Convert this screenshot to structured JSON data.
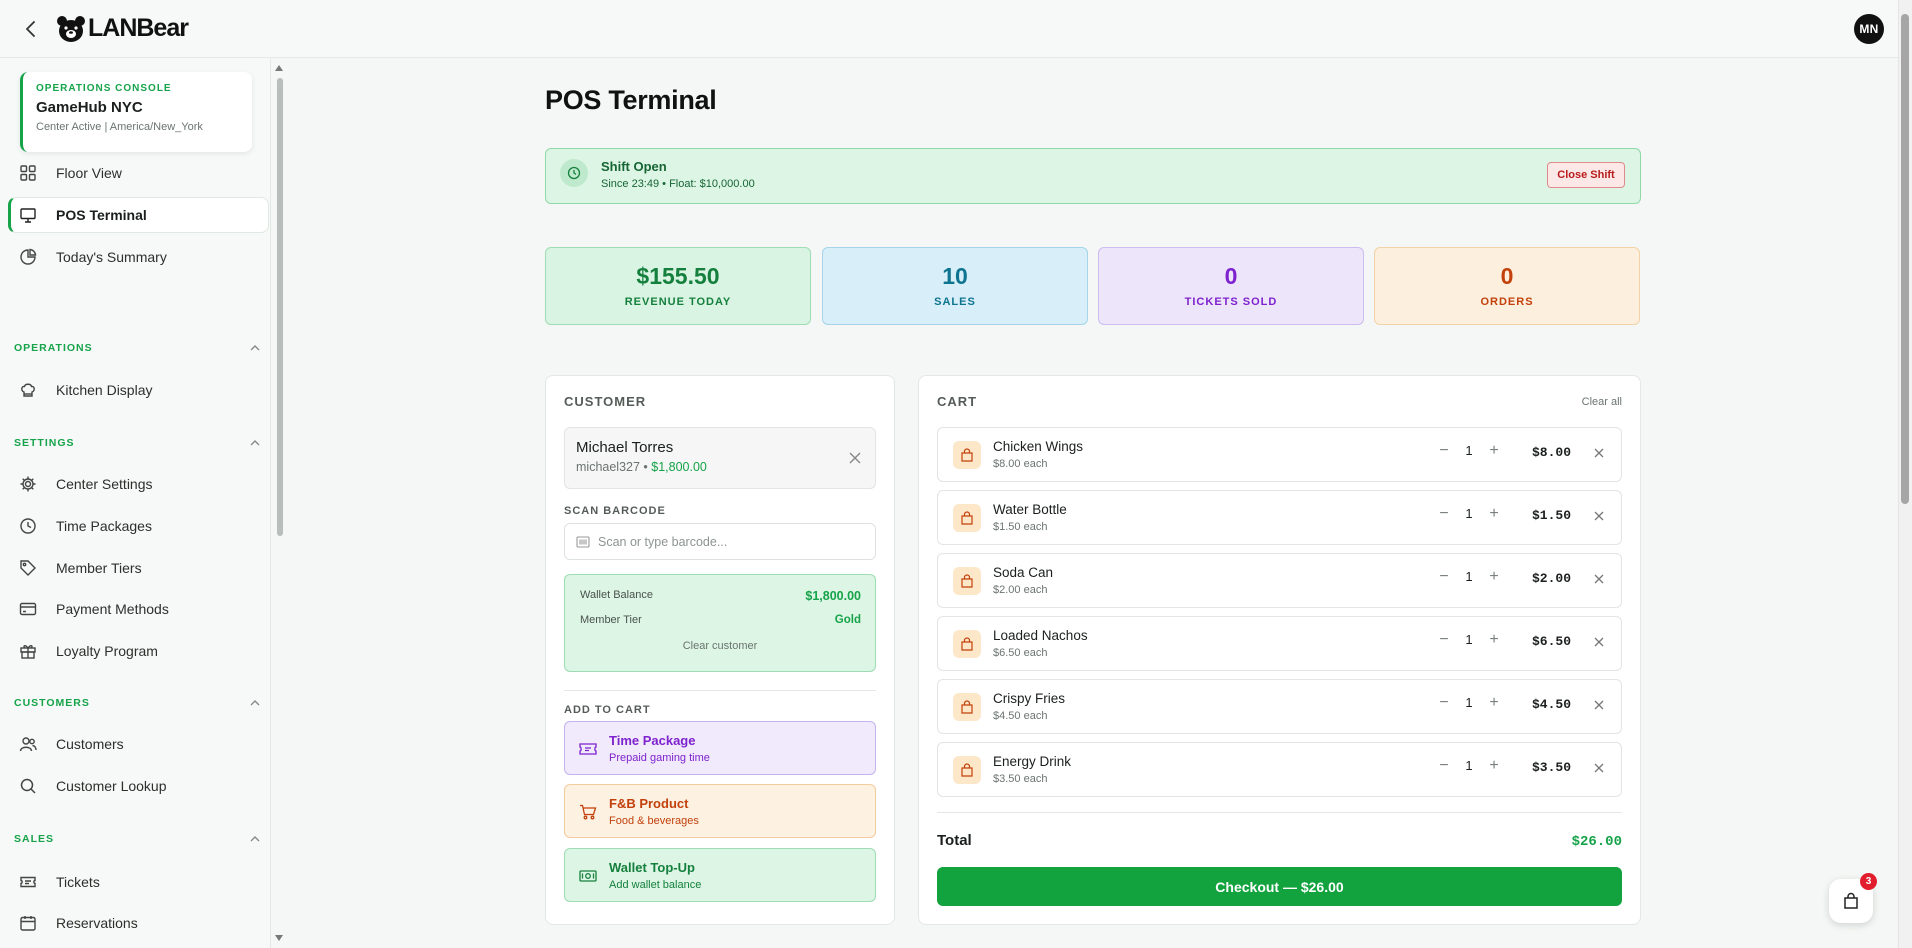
{
  "app": {
    "name": "LANBear",
    "user_initials": "MN"
  },
  "ops_card": {
    "kicker": "OPERATIONS CONSOLE",
    "title": "GameHub NYC",
    "subtitle": "Center Active  |  America/New_York"
  },
  "sidebar": {
    "top_items": [
      {
        "label": "Floor View",
        "icon": "grid-icon"
      },
      {
        "label": "POS Terminal",
        "icon": "monitor-icon",
        "active": true
      },
      {
        "label": "Today's Summary",
        "icon": "pie-chart-icon"
      }
    ],
    "sections": [
      {
        "title": "OPERATIONS",
        "items": [
          {
            "label": "Kitchen Display",
            "icon": "chef-hat-icon"
          }
        ]
      },
      {
        "title": "SETTINGS",
        "items": [
          {
            "label": "Center Settings",
            "icon": "gear-icon"
          },
          {
            "label": "Time Packages",
            "icon": "clock-icon"
          },
          {
            "label": "Member Tiers",
            "icon": "tag-icon"
          },
          {
            "label": "Payment Methods",
            "icon": "credit-card-icon"
          },
          {
            "label": "Loyalty Program",
            "icon": "gift-icon"
          }
        ]
      },
      {
        "title": "CUSTOMERS",
        "items": [
          {
            "label": "Customers",
            "icon": "users-icon"
          },
          {
            "label": "Customer Lookup",
            "icon": "search-icon"
          }
        ]
      },
      {
        "title": "SALES",
        "items": [
          {
            "label": "Tickets",
            "icon": "ticket-icon"
          },
          {
            "label": "Reservations",
            "icon": "calendar-icon"
          }
        ]
      }
    ]
  },
  "page": {
    "title": "POS Terminal"
  },
  "shift": {
    "title": "Shift Open",
    "subtitle": "Since 23:49 • Float: $10,000.00",
    "close_label": "Close Shift"
  },
  "stats": [
    {
      "value": "$155.50",
      "label": "REVENUE TODAY"
    },
    {
      "value": "10",
      "label": "SALES"
    },
    {
      "value": "0",
      "label": "TICKETS SOLD"
    },
    {
      "value": "0",
      "label": "ORDERS"
    }
  ],
  "colors": {
    "accent": "#16a34a",
    "revenue": "#15803d",
    "sales": "#0e7490",
    "tickets": "#7e22ce",
    "orders": "#c2410c",
    "danger": "#b91c1c"
  },
  "customer": {
    "heading": "CUSTOMER",
    "name": "Michael Torres",
    "username": "michael327",
    "balance": "$1,800.00",
    "scan_label": "SCAN BARCODE",
    "scan_placeholder": "Scan or type barcode...",
    "wallet_label": "Wallet Balance",
    "wallet_value": "$1,800.00",
    "tier_label": "Member Tier",
    "tier_value": "Gold",
    "clear_label": "Clear customer",
    "add_heading": "ADD TO CART",
    "add_options": [
      {
        "title": "Time Package",
        "subtitle": "Prepaid gaming time",
        "icon": "ticket-icon"
      },
      {
        "title": "F&B Product",
        "subtitle": "Food & beverages",
        "icon": "cart-icon"
      },
      {
        "title": "Wallet Top-Up",
        "subtitle": "Add wallet balance",
        "icon": "cash-icon"
      }
    ]
  },
  "cart": {
    "heading": "CART",
    "clear_all": "Clear all",
    "items": [
      {
        "name": "Chicken Wings",
        "each": "$8.00 each",
        "qty": "1",
        "price": "$8.00"
      },
      {
        "name": "Water Bottle",
        "each": "$1.50 each",
        "qty": "1",
        "price": "$1.50"
      },
      {
        "name": "Soda Can",
        "each": "$2.00 each",
        "qty": "1",
        "price": "$2.00"
      },
      {
        "name": "Loaded Nachos",
        "each": "$6.50 each",
        "qty": "1",
        "price": "$6.50"
      },
      {
        "name": "Crispy Fries",
        "each": "$4.50 each",
        "qty": "1",
        "price": "$4.50"
      },
      {
        "name": "Energy Drink",
        "each": "$3.50 each",
        "qty": "1",
        "price": "$3.50"
      }
    ],
    "total_label": "Total",
    "total_value": "$26.00",
    "checkout_label": "Checkout — $26.00"
  },
  "floating_cart": {
    "badge": "3"
  }
}
